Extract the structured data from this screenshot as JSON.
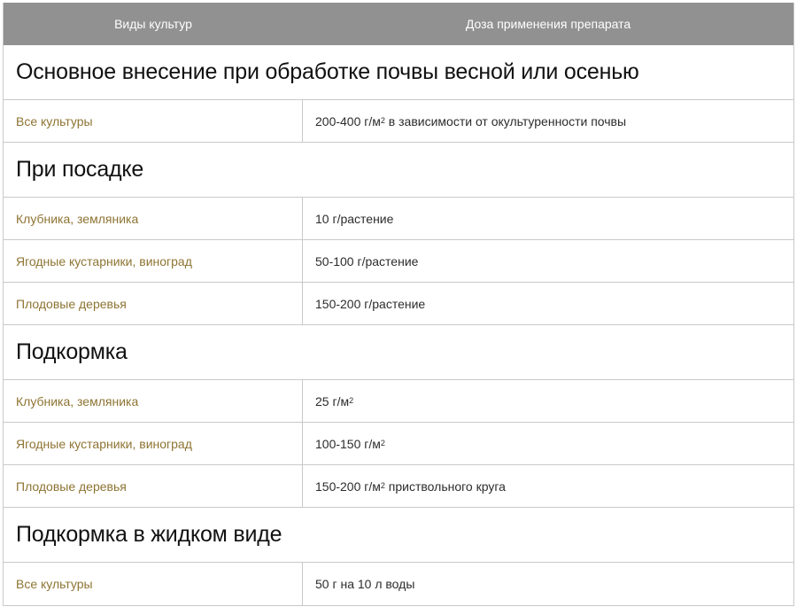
{
  "header": {
    "col1": "Виды культур",
    "col2": "Доза применения препарата"
  },
  "sections": [
    {
      "title": "Основное внесение при обработке почвы весной или осенью",
      "rows": [
        {
          "crop": "Все культуры",
          "dose": "200-400 г/м",
          "sup": "2",
          "suffix": " в зависимости от окультуренности почвы"
        }
      ]
    },
    {
      "title": "При посадке",
      "rows": [
        {
          "crop": "Клубника, земляника",
          "dose": "10 г/растение"
        },
        {
          "crop": "Ягодные кустарники, виноград",
          "dose": "50-100 г/растение"
        },
        {
          "crop": "Плодовые деревья",
          "dose": "150-200 г/растение"
        }
      ]
    },
    {
      "title": "Подкормка",
      "rows": [
        {
          "crop": "Клубника, земляника",
          "dose": "25 г/м",
          "sup": "2"
        },
        {
          "crop": "Ягодные кустарники, виноград",
          "dose": "100-150 г/м",
          "sup": "2"
        },
        {
          "crop": "Плодовые деревья",
          "dose": "150-200 г/м",
          "sup": "2",
          "suffix": " приствольного круга"
        }
      ]
    },
    {
      "title": "Подкормка в жидком виде",
      "rows": [
        {
          "crop": "Все культуры",
          "dose": "50 г на 10 л воды"
        }
      ]
    }
  ],
  "colors": {
    "header_bg": "#919191",
    "crop_text": "#8e7433",
    "border": "#c9c9c9"
  }
}
